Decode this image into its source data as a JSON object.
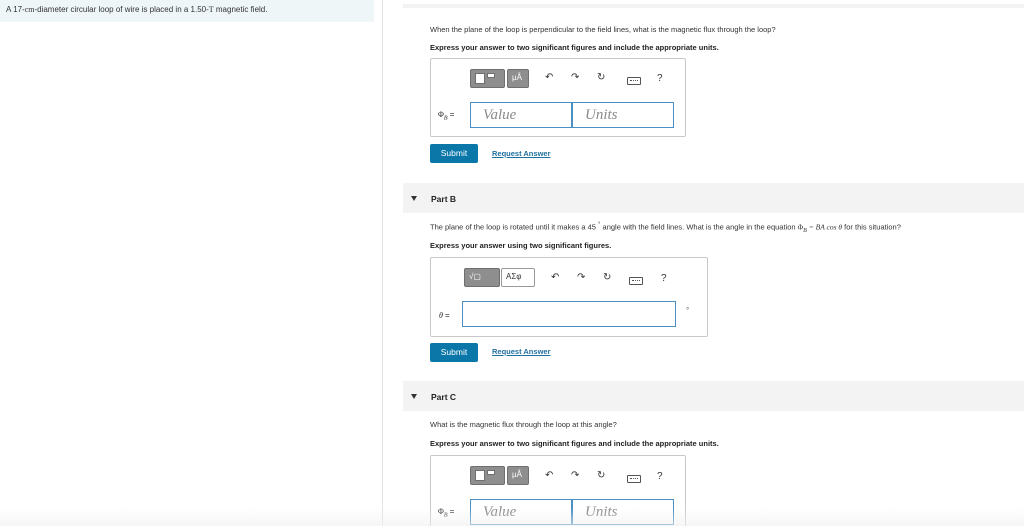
{
  "problem": {
    "text_before": "A 17-",
    "unit_cm": "cm",
    "text_middle": "-diameter circular loop of wire is placed in a 1.50-",
    "unit_T": "T",
    "text_after": " magnetic field."
  },
  "toolbar": {
    "template_label": "▪▫",
    "mu_label": "µÅ",
    "sqrt_label": "√▢",
    "greek_label": "ΑΣφ",
    "undo": "↶",
    "redo": "↷",
    "reset": "↻",
    "help": "?"
  },
  "partA": {
    "question": "When the plane of the loop is perpendicular to the field lines, what is the magnetic flux through the loop?",
    "instruction": "Express your answer to two significant figures and include the appropriate units.",
    "symbol": "Φ",
    "symbol_sub": "B",
    "equals": "=",
    "value_placeholder": "Value",
    "units_placeholder": "Units",
    "submit_label": "Submit",
    "request_label": "Request Answer"
  },
  "partB": {
    "title": "Part B",
    "question_1": "The plane of the loop is rotated until it makes a 45 ",
    "degree": "°",
    "question_2": " angle with the field lines. What is the angle in the equation ",
    "eq_phi": "Φ",
    "eq_sub": "B",
    "eq_rest": " = BA cos θ",
    "question_3": " for this situation?",
    "instruction": "Express your answer using two significant figures.",
    "symbol": "θ",
    "equals": "=",
    "unit_suffix": "°",
    "submit_label": "Submit",
    "request_label": "Request Answer"
  },
  "partC": {
    "title": "Part C",
    "question": "What is the magnetic flux through the loop at this angle?",
    "instruction": "Express your answer to two significant figures and include the appropriate units.",
    "symbol": "Φ",
    "symbol_sub": "B",
    "equals": "=",
    "value_placeholder": "Value",
    "units_placeholder": "Units"
  }
}
